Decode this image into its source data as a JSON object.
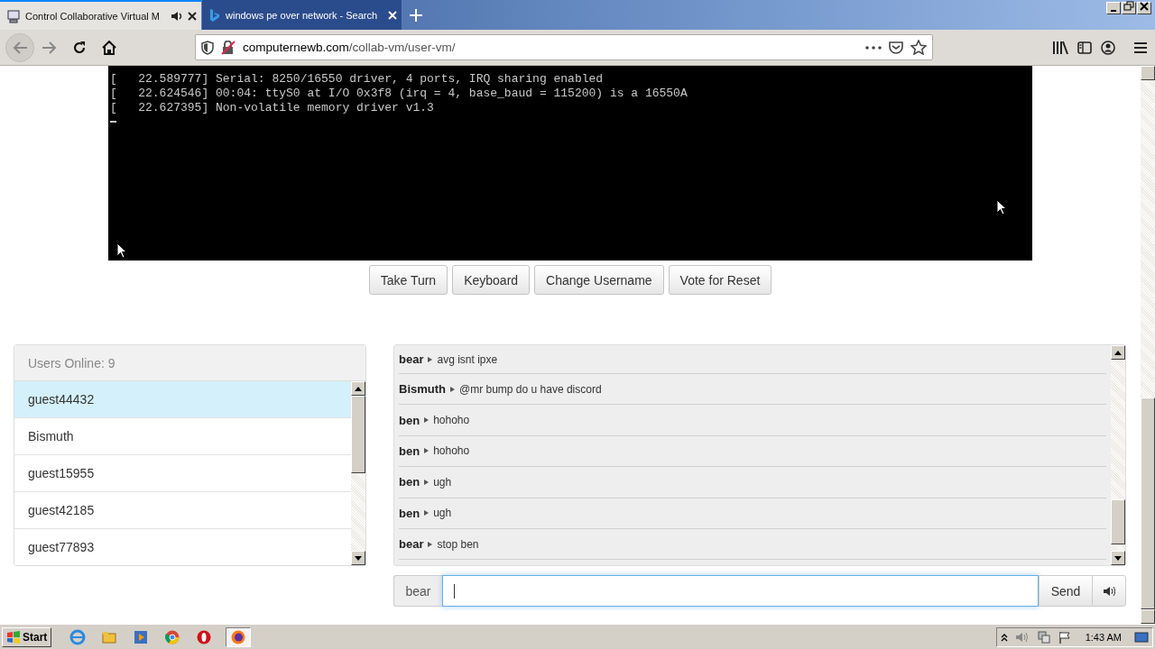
{
  "browser": {
    "tabs": [
      {
        "title": "Control Collaborative Virtual M",
        "selected": true,
        "audio": true
      },
      {
        "title": "windows pe over network - Search",
        "selected": false
      }
    ],
    "url": {
      "host": "computernewb.com",
      "path": "/collab-vm/user-vm/"
    }
  },
  "vm_screen": {
    "lines": [
      "[   22.589777] Serial: 8250/16550 driver, 4 ports, IRQ sharing enabled",
      "[   22.624546] 00:04: ttyS0 at I/O 0x3f8 (irq = 4, base_baud = 115200) is a 16550A",
      "[   22.627395] Non-volatile memory driver v1.3"
    ],
    "cursor": true
  },
  "vm_buttons": [
    "Take Turn",
    "Keyboard",
    "Change Username",
    "Vote for Reset"
  ],
  "users": {
    "header": "Users Online: 9",
    "items": [
      {
        "name": "guest44432",
        "selected": true
      },
      {
        "name": "Bismuth",
        "selected": false
      },
      {
        "name": "guest15955",
        "selected": false
      },
      {
        "name": "guest42185",
        "selected": false
      },
      {
        "name": "guest77893",
        "selected": false
      }
    ]
  },
  "chat": {
    "messages": [
      {
        "user": "bear",
        "text": "avg isnt ipxe"
      },
      {
        "user": "Bismuth",
        "text": "@mr bump do u have discord"
      },
      {
        "user": "ben",
        "text": "hohoho"
      },
      {
        "user": "ben",
        "text": "hohoho"
      },
      {
        "user": "ben",
        "text": "ugh"
      },
      {
        "user": "ben",
        "text": "ugh"
      },
      {
        "user": "bear",
        "text": "stop ben"
      }
    ],
    "username": "bear",
    "send": "Send"
  },
  "taskbar": {
    "start": "Start",
    "clock": "1:43 AM"
  }
}
